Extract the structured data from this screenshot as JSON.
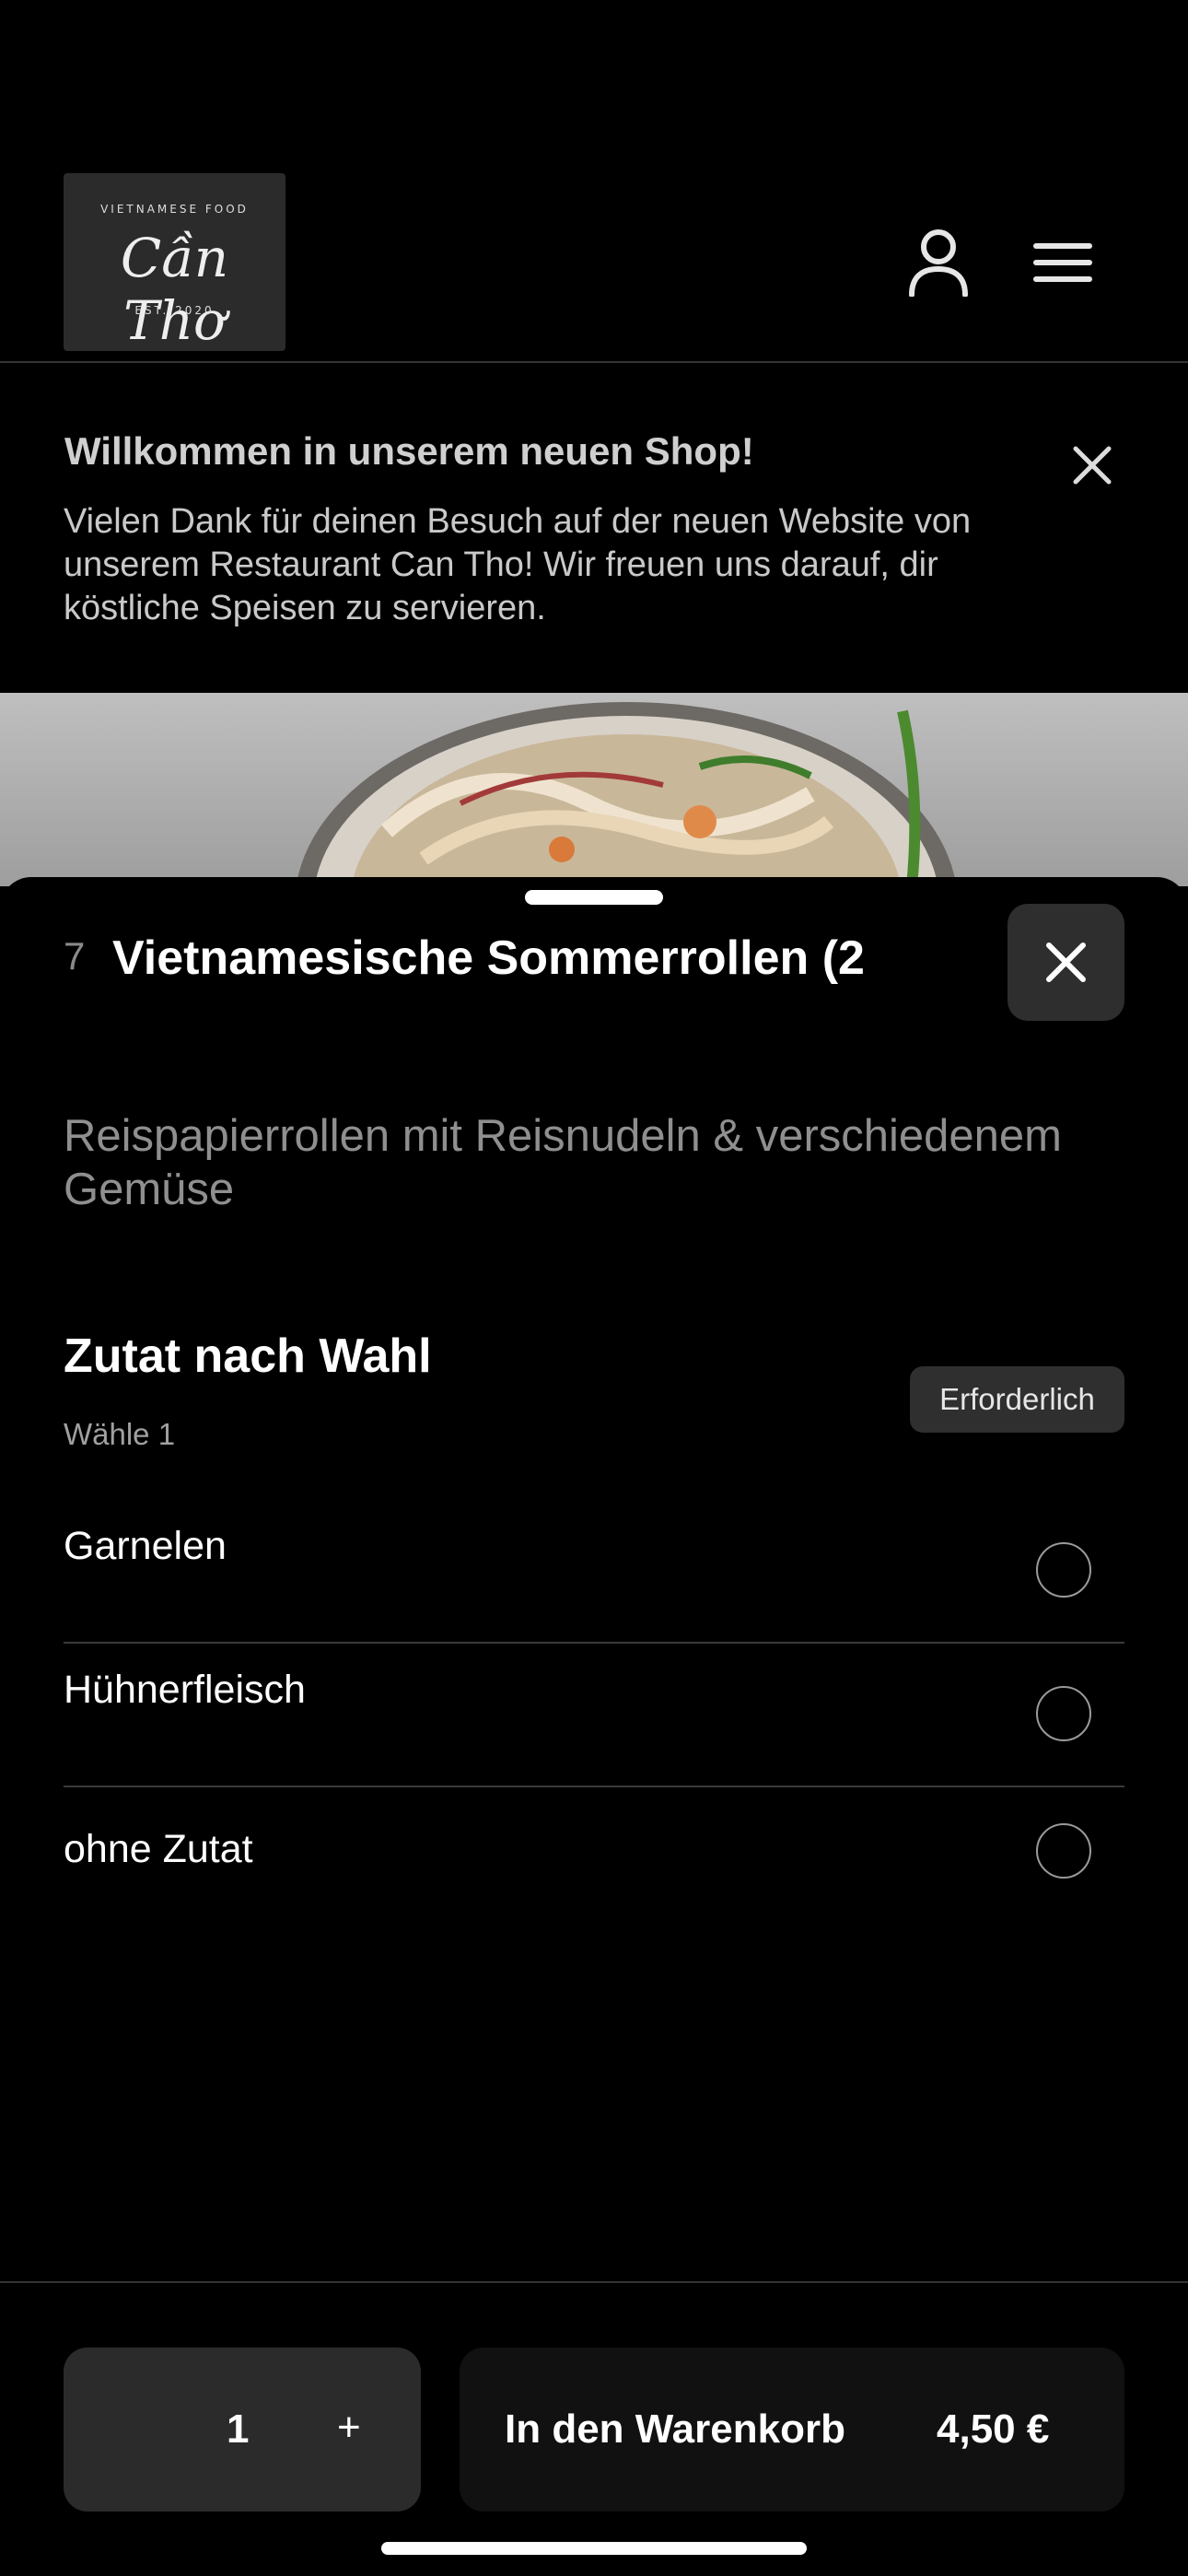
{
  "header": {
    "logo": {
      "top_text": "VIETNAMESE FOOD",
      "script_text": "Cần Thơ",
      "bottom_text": "EST. 2020"
    },
    "user_icon": "user-icon",
    "menu_icon": "menu-icon"
  },
  "banner": {
    "title": "Willkommen in unserem neuen Shop!",
    "text": "Vielen Dank für deinen Besuch auf der neuen Website von unserem Restaurant Can Tho! Wir freuen uns darauf, dir köstliche Speisen zu servieren.",
    "close_icon": "close-icon"
  },
  "item": {
    "number": "7",
    "title": "Vietnamesische Sommerrollen (2",
    "description": "Reispapierrollen mit Reisnudeln & verschiedenem Gemüse"
  },
  "option_group": {
    "title": "Zutat nach Wahl",
    "subtitle": "Wähle 1",
    "badge": "Erforderlich",
    "options": [
      {
        "label": "Garnelen",
        "selected": false
      },
      {
        "label": "Hühnerfleisch",
        "selected": false
      },
      {
        "label": "ohne Zutat",
        "selected": false
      }
    ]
  },
  "footer": {
    "quantity": "1",
    "plus": "+",
    "add_label": "In den Warenkorb",
    "price": "4,50 €"
  },
  "colors": {
    "background": "#000000",
    "surface": "#2b2b2b",
    "muted_text": "#8f8f8f"
  }
}
